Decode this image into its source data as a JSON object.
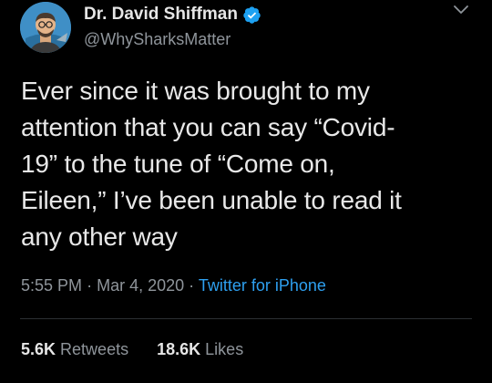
{
  "author": {
    "display_name": "Dr. David Shiffman",
    "handle": "@WhySharksMatter",
    "verified_icon": "verified-badge-icon",
    "avatar": "avatar-illustration"
  },
  "tweet": {
    "text_lines": [
      "Ever since it was brought to my",
      "attention that you can say “Covid-",
      "19” to the tune of “Come on,",
      "Eileen,” I’ve been unable to read it",
      "any other way"
    ],
    "time": "5:55 PM",
    "separator": "·",
    "date": "Mar 4, 2020",
    "source": "Twitter for iPhone"
  },
  "stats": {
    "retweets_value": "5.6K",
    "retweets_label": "Retweets",
    "likes_value": "18.6K",
    "likes_label": "Likes"
  },
  "colors": {
    "background": "#000000",
    "link": "#2ea0f0",
    "verified": "#1da1f2",
    "muted": "#8f959b"
  }
}
